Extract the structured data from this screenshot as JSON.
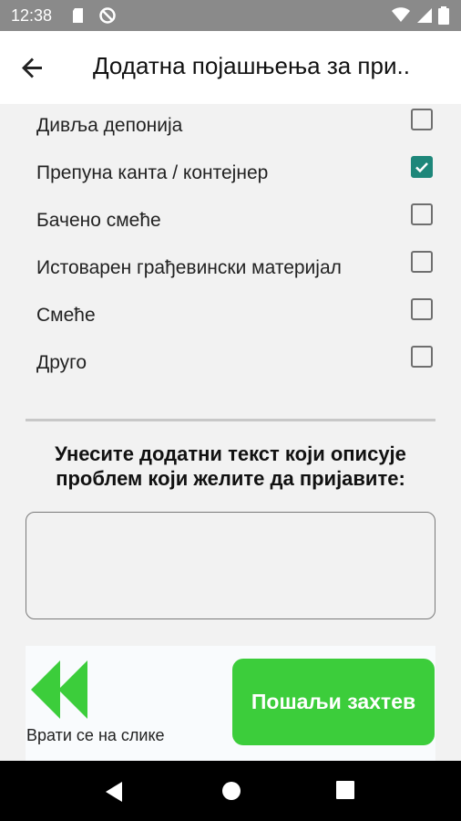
{
  "status_bar": {
    "time": "12:38",
    "icons": [
      "sd-card-icon",
      "data-saver-icon",
      "wifi-icon",
      "signal-icon",
      "battery-icon"
    ]
  },
  "app_bar": {
    "title": "Додатна појашњења за при..",
    "back_icon": "arrow-back-icon"
  },
  "options": [
    {
      "label": "Дивља депонија",
      "checked": false
    },
    {
      "label": "Препуна канта / контејнер",
      "checked": true
    },
    {
      "label": "Бачено смеће",
      "checked": false
    },
    {
      "label": "Истоварен грађевински материјал",
      "checked": false
    },
    {
      "label": "Смеће",
      "checked": false
    },
    {
      "label": "Друго",
      "checked": false
    }
  ],
  "prompt": "Унесите додатни текст који описује проблем који желите да пријавите:",
  "description_input": {
    "value": "",
    "placeholder": ""
  },
  "back_to_images": {
    "label": "Врати се на слике",
    "icon": "rewind-icon"
  },
  "send_button": {
    "label": "Пошаљи захтев"
  },
  "colors": {
    "accent": "#1e877a",
    "send": "#3ccd3b",
    "rewind": "#3ccd3b"
  },
  "nav_bar": {
    "icons": [
      "nav-back-icon",
      "nav-home-icon",
      "nav-recents-icon"
    ]
  }
}
